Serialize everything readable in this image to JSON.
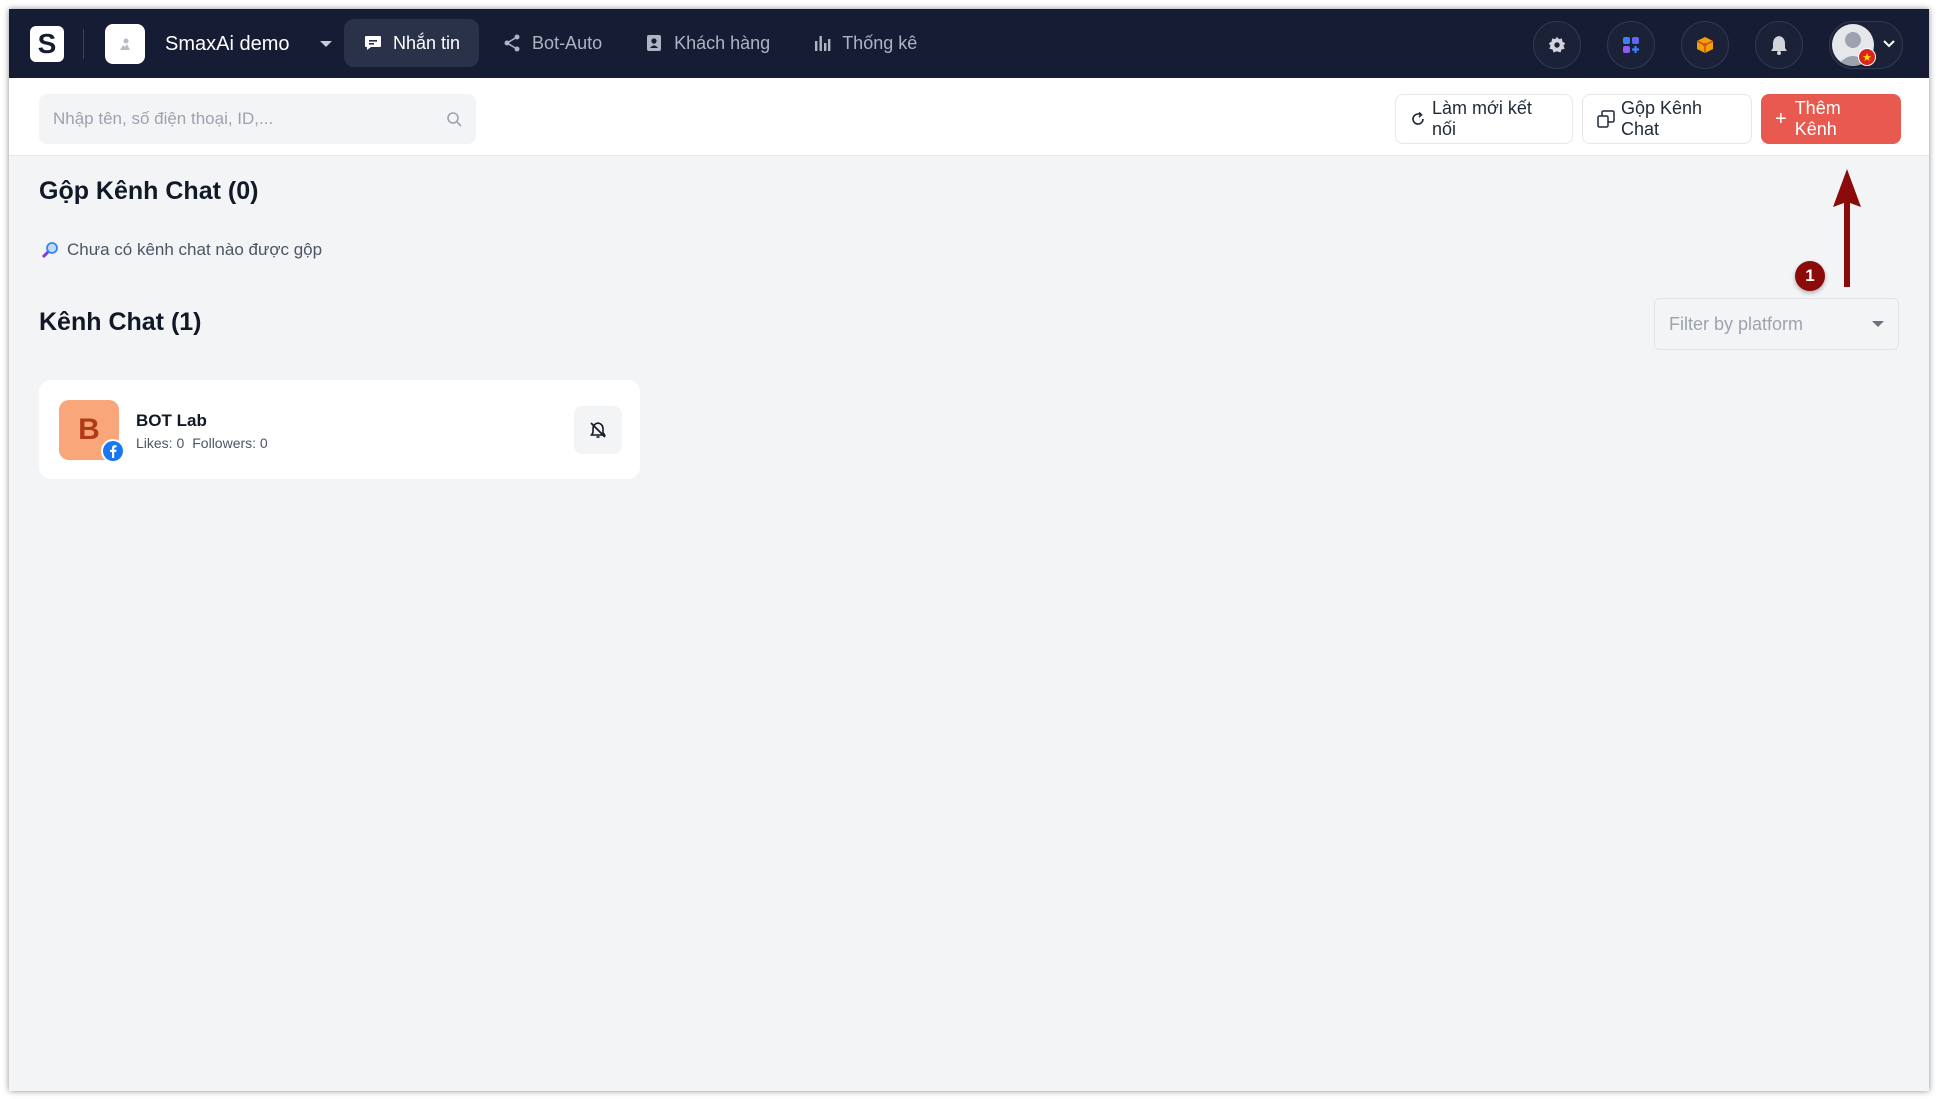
{
  "app": {
    "logo_letter": "S",
    "workspace_name": "SmaxAi demo"
  },
  "nav": {
    "items": [
      {
        "label": "Nhắn tin",
        "icon": "chat-bubble-icon",
        "active": true
      },
      {
        "label": "Bot-Auto",
        "icon": "share-nodes-icon",
        "active": false
      },
      {
        "label": "Khách hàng",
        "icon": "contact-card-icon",
        "active": false
      },
      {
        "label": "Thống kê",
        "icon": "bar-chart-icon",
        "active": false
      }
    ]
  },
  "header_icons": [
    "gear-icon",
    "apps-grid-icon",
    "box-icon",
    "bell-icon"
  ],
  "toolbar": {
    "search_placeholder": "Nhập tên, số điện thoại, ID,...",
    "refresh_label": "Làm mới kết nối",
    "merge_label": "Gộp Kênh Chat",
    "add_label": "Thêm Kênh"
  },
  "merged": {
    "title": "Gộp Kênh Chat (0)",
    "empty_text": "Chưa có kênh chat nào được gộp"
  },
  "channels": {
    "title": "Kênh Chat (1)",
    "filter_placeholder": "Filter by platform",
    "items": [
      {
        "initial": "B",
        "name": "BOT Lab",
        "likes": "Likes: 0",
        "followers": "Followers: 0",
        "platform": "facebook"
      }
    ]
  },
  "annotation": {
    "step": "1"
  },
  "colors": {
    "topbar": "#151c33",
    "accent_button": "#e85a4f",
    "annotation": "#8b0a0a",
    "avatar_bg": "#f9a77a",
    "facebook": "#1877f2"
  }
}
